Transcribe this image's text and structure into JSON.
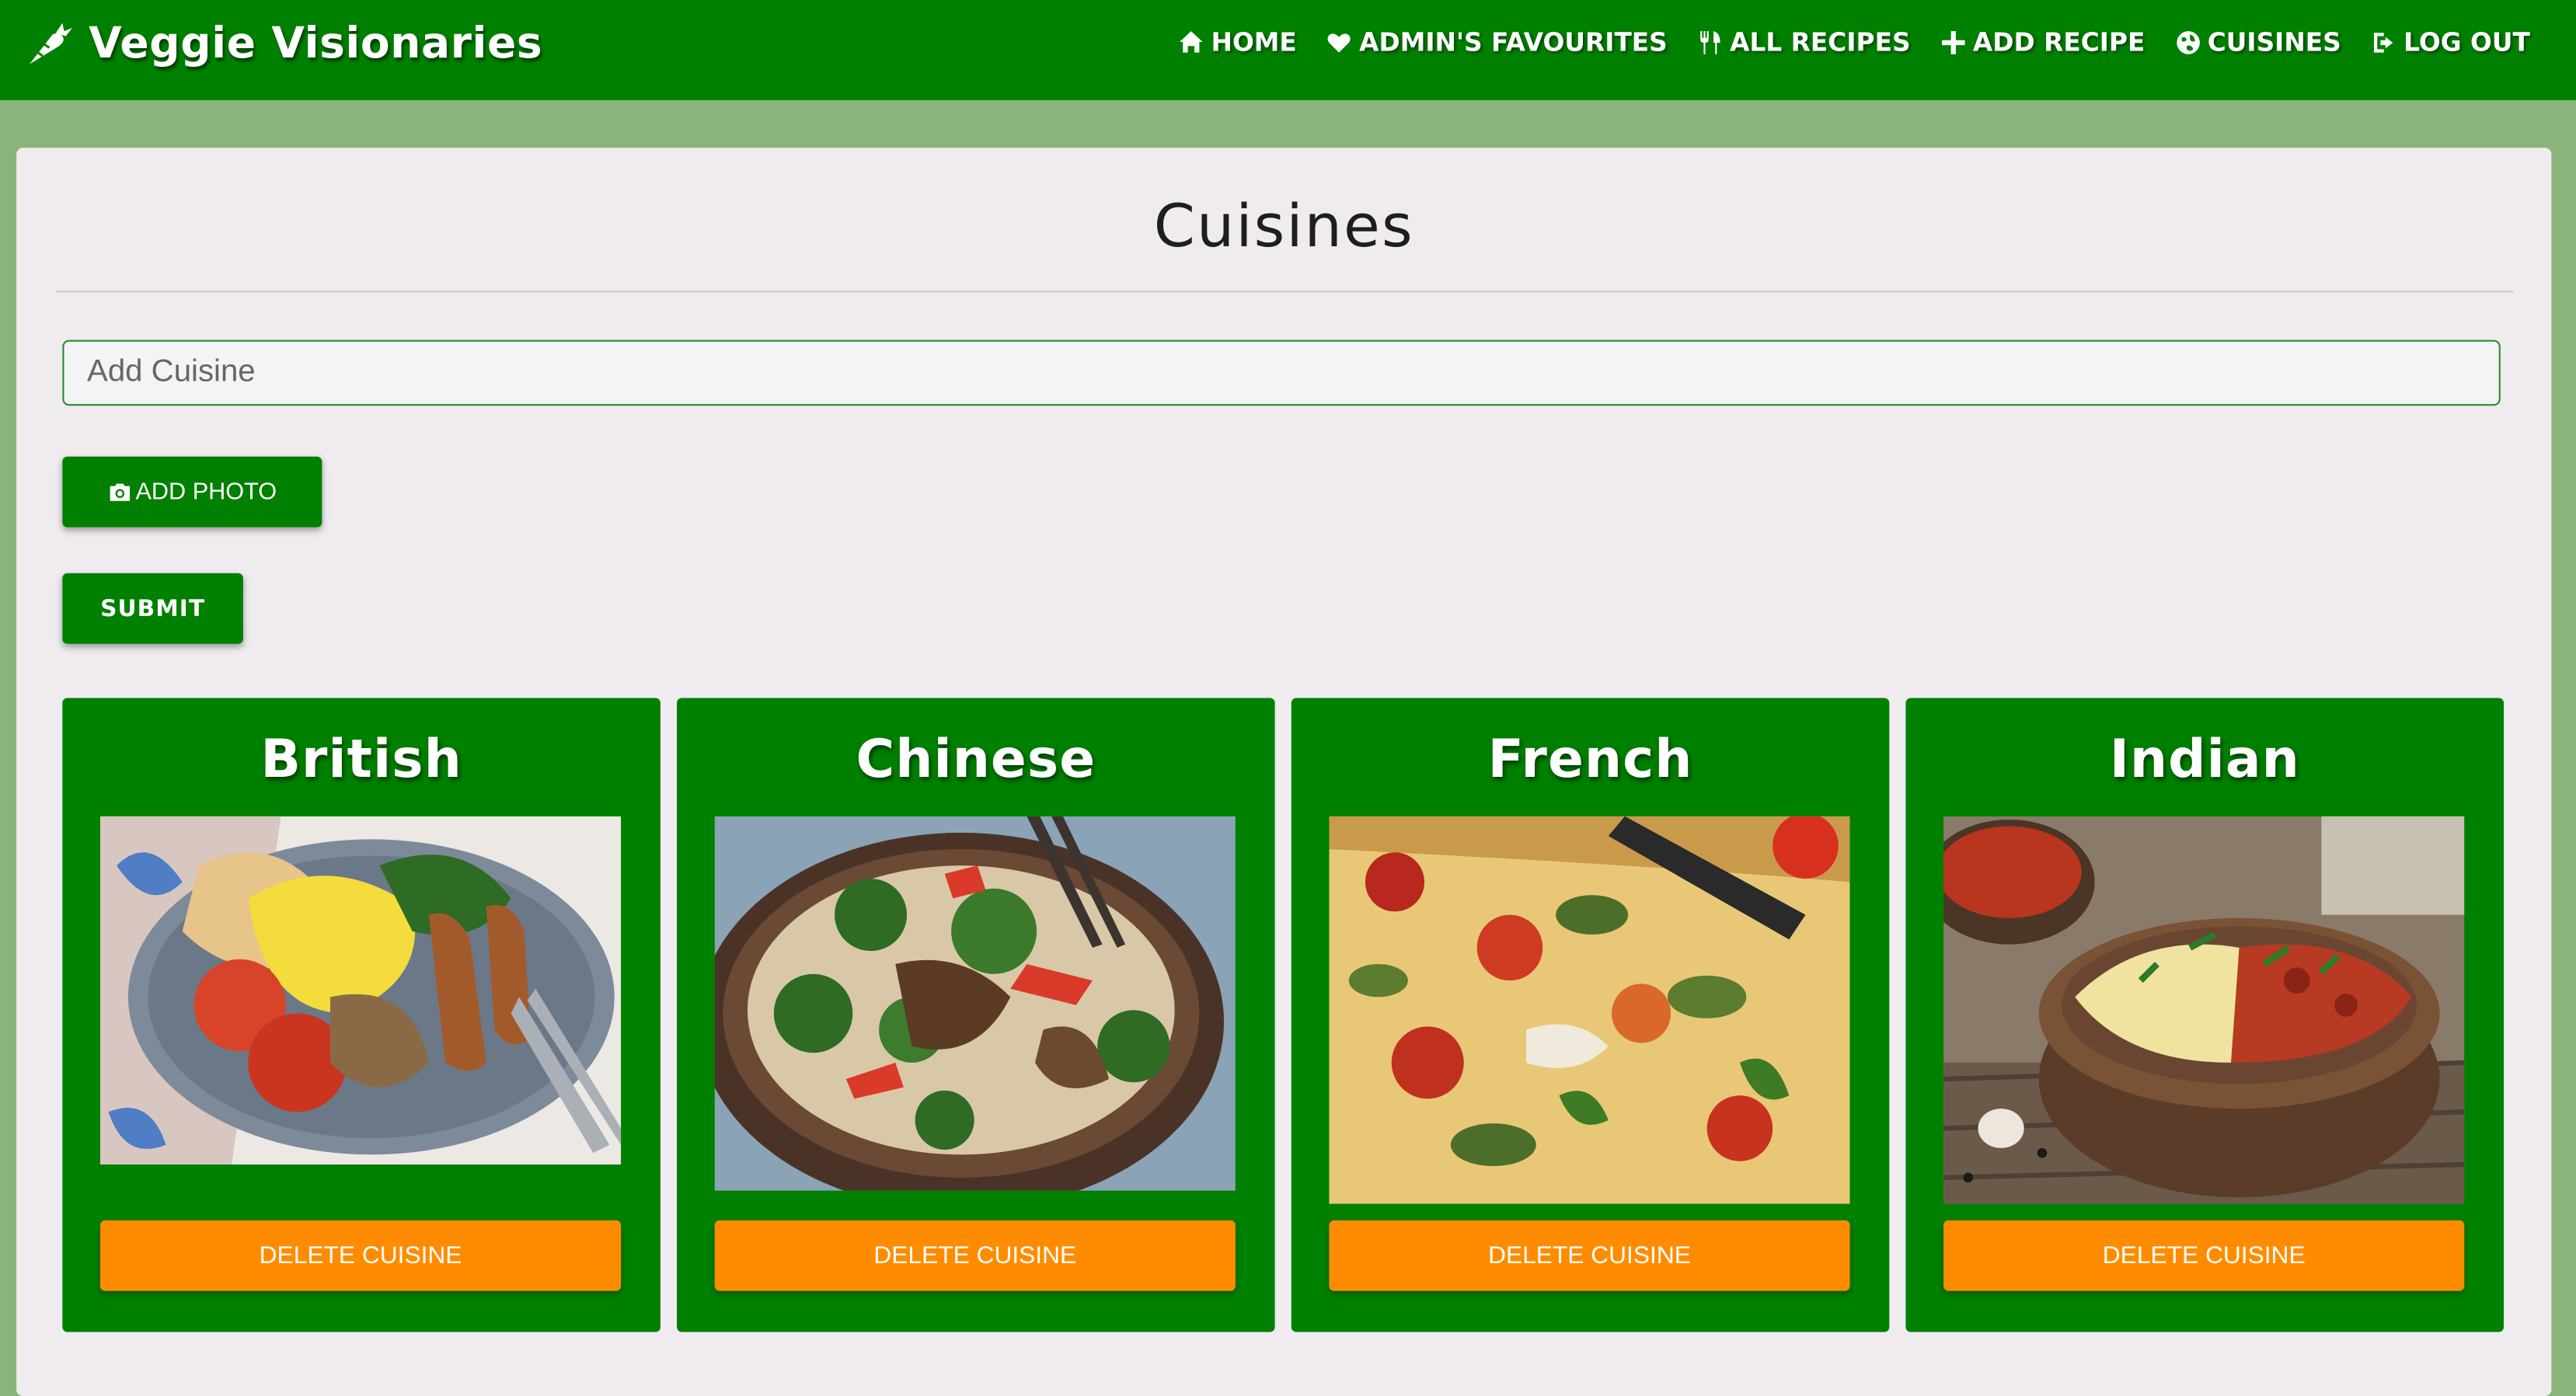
{
  "brand": {
    "name": "Veggie Visionaries",
    "icon": "carrot-icon"
  },
  "nav": [
    {
      "label": "HOME",
      "icon": "home-icon"
    },
    {
      "label": "ADMIN'S FAVOURITES",
      "icon": "heart-icon"
    },
    {
      "label": "ALL RECIPES",
      "icon": "utensils-icon"
    },
    {
      "label": "ADD RECIPE",
      "icon": "plus-icon"
    },
    {
      "label": "CUISINES",
      "icon": "globe-icon"
    },
    {
      "label": "LOG OUT",
      "icon": "logout-icon"
    }
  ],
  "page": {
    "title": "Cuisines"
  },
  "form": {
    "input_placeholder": "Add Cuisine",
    "add_photo_label": "ADD PHOTO",
    "submit_label": "SUBMIT"
  },
  "cuisines": [
    {
      "name": "British",
      "delete_label": "DELETE CUISINE"
    },
    {
      "name": "Chinese",
      "delete_label": "DELETE CUISINE"
    },
    {
      "name": "French",
      "delete_label": "DELETE CUISINE"
    },
    {
      "name": "Indian",
      "delete_label": "DELETE CUISINE"
    }
  ],
  "colors": {
    "nav": "#008000",
    "background": "#8ab47a",
    "panel": "#efebef",
    "card": "#008000",
    "delete_button": "#ff8c00"
  }
}
